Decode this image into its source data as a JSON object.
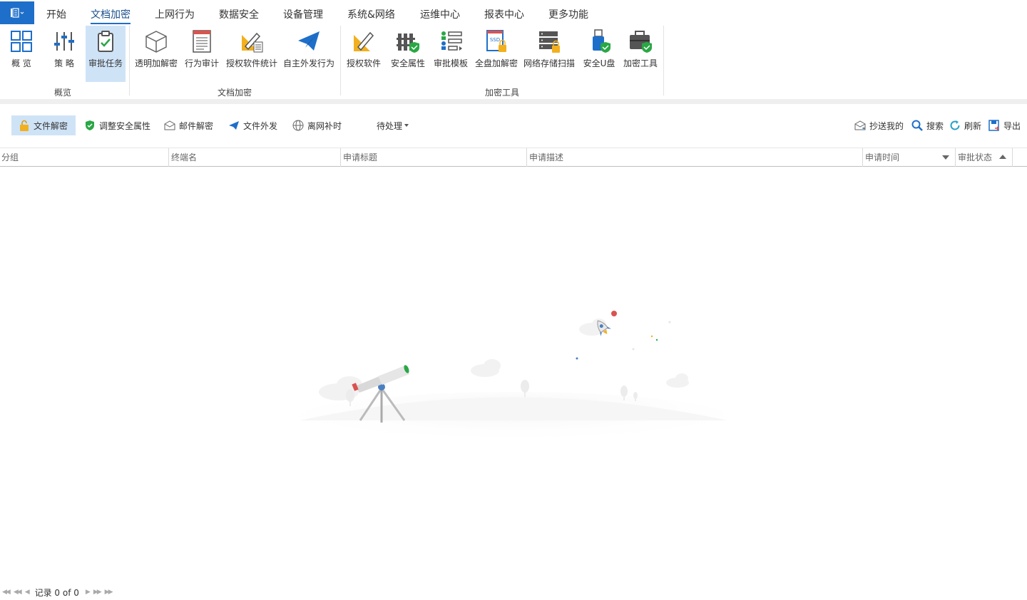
{
  "menu": {
    "tabs": [
      "开始",
      "文档加密",
      "上网行为",
      "数据安全",
      "设备管理",
      "系统&网络",
      "运维中心",
      "报表中心",
      "更多功能"
    ],
    "active_tab": "文档加密"
  },
  "ribbon": {
    "groups": [
      {
        "label": "概览",
        "buttons": [
          "概 览",
          "策 略",
          "审批任务"
        ]
      },
      {
        "label": "文档加密",
        "buttons": [
          "透明加解密",
          "行为审计",
          "授权软件统计",
          "自主外发行为"
        ]
      },
      {
        "label": "加密工具",
        "buttons": [
          "授权软件",
          "安全属性",
          "审批模板",
          "全盘加解密",
          "网络存储扫描",
          "安全U盘",
          "加密工具"
        ]
      }
    ],
    "active_button": "审批任务",
    "ssd_badge": "SSD"
  },
  "toolbar": {
    "left": [
      "文件解密",
      "调整安全属性",
      "邮件解密",
      "文件外发",
      "离网补时"
    ],
    "active": "文件解密",
    "filter": "待处理",
    "right": [
      "抄送我的",
      "搜索",
      "刷新",
      "导出"
    ]
  },
  "grid": {
    "columns": [
      "分组",
      "终端名",
      "申请标题",
      "申请描述",
      "申请时间",
      "审批状态"
    ]
  },
  "pager": {
    "text": "记录 0 of 0"
  },
  "colors": {
    "accent": "#1e6fc9",
    "active_bg": "#cfe3f7"
  }
}
